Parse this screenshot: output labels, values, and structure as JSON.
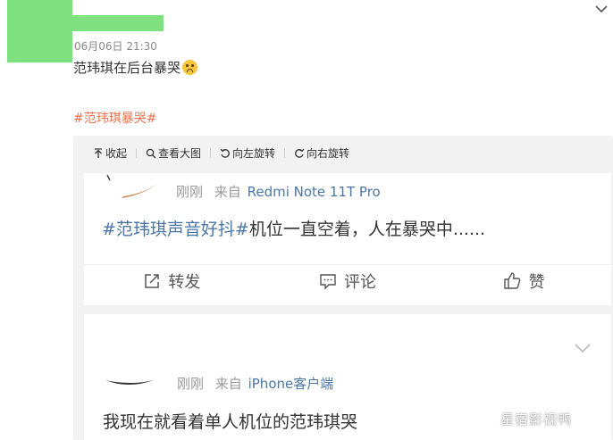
{
  "post": {
    "timestamp": "06月06日 21:30",
    "text": "范玮琪在后台暴哭",
    "emoji": "sad-face-emoji",
    "hashtag": "#范玮琪暴哭#"
  },
  "toolbar": {
    "collapse": "收起",
    "view_large": "查看大图",
    "rotate_left": "向左旋转",
    "rotate_right": "向右旋转"
  },
  "embedded_cards": [
    {
      "time": "刚刚",
      "source_prefix": "来自",
      "source": "Redmi Note 11T Pro",
      "hashtag": "#范玮琪声音好抖#",
      "body": "机位一直空着，人在暴哭中......",
      "actions": {
        "repost": "转发",
        "comment": "评论",
        "like": "赞"
      }
    },
    {
      "time": "刚刚",
      "source_prefix": "来自",
      "source": "iPhone客户端",
      "body": "我现在就看着单人机位的范玮琪哭"
    }
  ],
  "watermark": "星宿影视鸭",
  "colors": {
    "redacted_block": "#7fe07f",
    "hashtag_orange": "#eb7350",
    "link_blue": "#4a76a8"
  }
}
